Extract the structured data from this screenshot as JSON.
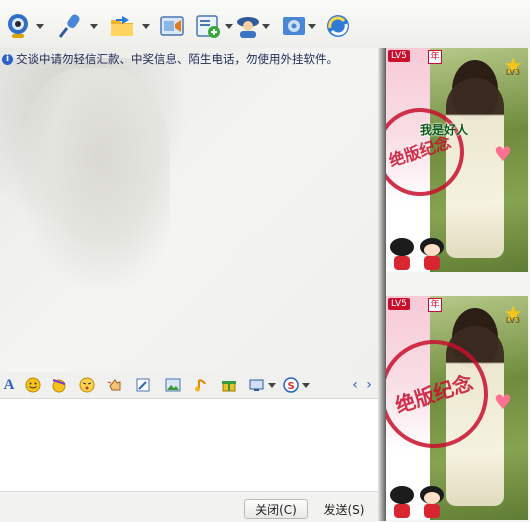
{
  "toolbar": {
    "items": [
      {
        "icon": "webcam-icon",
        "has_dropdown": true
      },
      {
        "icon": "microphone-icon",
        "has_dropdown": true
      },
      {
        "icon": "folder-transfer-icon",
        "has_dropdown": true
      },
      {
        "icon": "screenshot-icon",
        "has_dropdown": false
      },
      {
        "icon": "add-app-icon",
        "has_dropdown": true
      },
      {
        "icon": "user-profile-icon",
        "has_dropdown": true
      },
      {
        "icon": "settings-icon",
        "has_dropdown": true
      },
      {
        "icon": "remote-assist-icon",
        "has_dropdown": false
      }
    ]
  },
  "chat": {
    "notice": "交谈中请勿轻信汇款、中奖信息、陌生电话，勿使用外挂软件。"
  },
  "format_toolbar": {
    "items": [
      "font-icon",
      "smiley-icon",
      "magic-emoticon-icon",
      "mood-icon",
      "nudge-icon",
      "handwriting-icon",
      "image-icon",
      "music-icon",
      "gift-icon",
      "screen-capture-icon",
      "search-icon",
      "scroll-left-icon",
      "scroll-right-icon"
    ]
  },
  "input": {
    "value": ""
  },
  "buttons": {
    "close_label": "关闭(C)",
    "send_label": "发送(S)"
  },
  "profiles": [
    {
      "level_badge": "LV5",
      "year_badge": "年",
      "rank_badge": "LV3",
      "nickname": "我是好人",
      "stamp_text": "绝版纪念"
    },
    {
      "level_badge": "LV5",
      "year_badge": "年",
      "rank_badge": "LV3",
      "nickname": "",
      "stamp_text": "绝版纪念"
    }
  ],
  "colors": {
    "notice_text": "#1f2a55",
    "info_icon": "#2a62c8",
    "badge_red": "#c8102e",
    "nickname": "#0a5a16"
  }
}
